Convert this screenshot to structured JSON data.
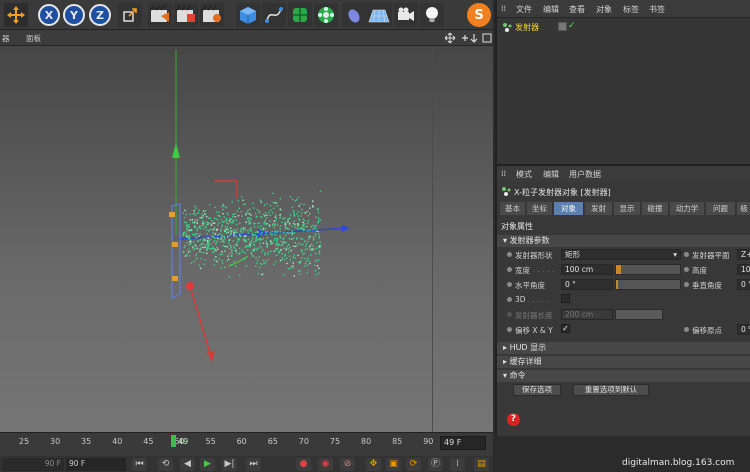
{
  "toolbar": {
    "axis_x": "X",
    "axis_y": "Y",
    "axis_z": "Z",
    "icons": [
      "move-icon",
      "axis-x-icon",
      "axis-y-icon",
      "axis-z-icon",
      "coordinate-system-icon",
      "render-view-icon",
      "render-picture-viewer-icon",
      "render-settings-icon",
      "cube-icon",
      "spline-pen-icon",
      "subdivision-icon",
      "mograph-cloner-icon",
      "deformer-icon",
      "floor-grid-icon",
      "camera-icon",
      "light-icon",
      "s-logo-icon"
    ]
  },
  "viewport": {
    "menu_partial": "器",
    "menu_panel": "面板",
    "nav_icons": [
      "move-view-icon",
      "zoom-view-icon",
      "rotate-view-icon",
      "toggle-view-icon"
    ]
  },
  "timeline": {
    "ticks": [
      "25",
      "30",
      "35",
      "40",
      "45",
      "50",
      "55",
      "60",
      "65",
      "70",
      "75",
      "80",
      "85",
      "90"
    ],
    "current_frame": "49",
    "frame_field": "49 F"
  },
  "playbar": {
    "start_field": "90 F",
    "end_field": "90 F",
    "buttons": [
      "go-to-start",
      "step-back",
      "play-back",
      "play-forward",
      "step-forward",
      "go-to-end"
    ]
  },
  "object_manager": {
    "menu": [
      "文件",
      "编辑",
      "查看",
      "对象",
      "标签",
      "书签"
    ],
    "object_name": "发射器",
    "check": "✓"
  },
  "attribute_manager": {
    "menu": [
      "模式",
      "编辑",
      "用户数据"
    ],
    "title": "X-粒子发射器对象 [发射器]",
    "tabs": [
      "基本",
      "坐标",
      "对象",
      "发射",
      "显示",
      "碰撞",
      "动力学",
      "问题",
      "极"
    ],
    "active_tab": "对象",
    "object_props_heading": "对象属性",
    "emitter_params_heading": "发射器参数",
    "emitter_shape_label": "发射器形状",
    "emitter_shape_value": "矩形",
    "emitter_plane_label": "发射器平面",
    "emitter_plane_value": "Z+",
    "width_label": "宽度",
    "width_value": "100 cm",
    "width_slider": 0.08,
    "height_label": "高度",
    "height_value": "10",
    "h_angle_label": "水平角度",
    "h_angle_value": "0 °",
    "h_angle_slider": 0.02,
    "v_angle_label": "垂直角度",
    "v_angle_value": "0 °",
    "threed_label": "3D",
    "emitter_length_label": "发射器长度",
    "emitter_length_value": "200 cm",
    "offset_xy_label": "偏移 X & Y",
    "offset_xy_check": "✓",
    "offset_origin_label": "偏移原点",
    "offset_origin_value": "0 %",
    "hud_heading": "HUD 显示",
    "cache_heading": "缓存详细",
    "command_heading": "命令",
    "save_preset_button": "保存选项",
    "reset_default_button": "重置选项到默认",
    "help_glyph": "?"
  },
  "watermark": "digitalman.blog.163.com"
}
